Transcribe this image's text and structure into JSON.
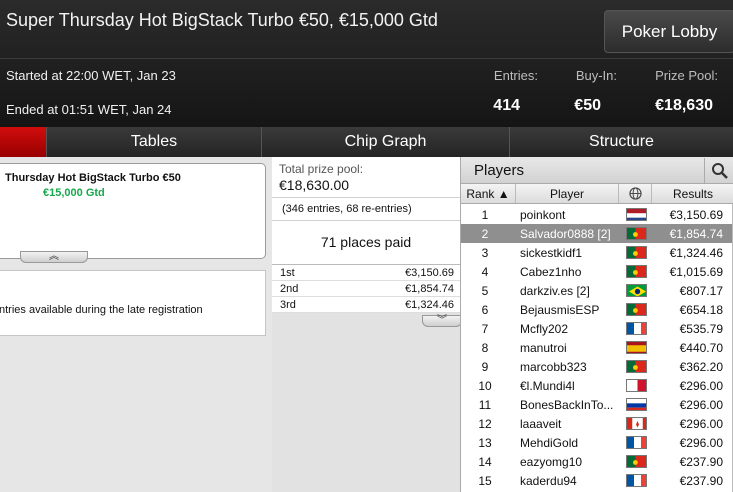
{
  "header": {
    "title": "Super Thursday Hot BigStack Turbo €50, €15,000 Gtd",
    "lobby_button": "Poker Lobby",
    "started": "Started at 22:00 WET, Jan 23",
    "ended": "Ended at 01:51 WET, Jan 24",
    "stats": {
      "entries_label": "Entries:",
      "entries_value": "414",
      "buyin_label": "Buy-In:",
      "buyin_value": "€50",
      "prize_label": "Prize Pool:",
      "prize_value": "€18,630"
    }
  },
  "tabs": [
    "",
    "Tables",
    "Chip Graph",
    "Structure"
  ],
  "left": {
    "card_title": "Thursday Hot BigStack Turbo €50",
    "card_gtd": "€15,000 Gtd",
    "expand_glyph": "︽",
    "note": "ntries available during the late registration"
  },
  "prize": {
    "label": "Total prize pool:",
    "value": "€18,630.00",
    "entries_note": "(346 entries, 68 re-entries)",
    "places": "71 places paid",
    "payouts": [
      {
        "place": "1st",
        "amount": "€3,150.69"
      },
      {
        "place": "2nd",
        "amount": "€1,854.74"
      },
      {
        "place": "3rd",
        "amount": "€1,324.46"
      }
    ],
    "expand_glyph": "︾"
  },
  "players": {
    "title": "Players",
    "search_icon": "magnifier-icon",
    "columns": {
      "rank": "Rank ▲",
      "player": "Player",
      "country": "globe-icon",
      "results": "Results"
    },
    "rows": [
      {
        "rank": "1",
        "name": "poinkont",
        "flag": "netherlands",
        "result": "€3,150.69"
      },
      {
        "rank": "2",
        "name": "Salvador0888 [2]",
        "flag": "portugal",
        "result": "€1,854.74"
      },
      {
        "rank": "3",
        "name": "sickestkidf1",
        "flag": "portugal",
        "result": "€1,324.46"
      },
      {
        "rank": "4",
        "name": "Cabez1nho",
        "flag": "portugal",
        "result": "€1,015.69"
      },
      {
        "rank": "5",
        "name": "darkziv.es [2]",
        "flag": "brazil",
        "result": "€807.17"
      },
      {
        "rank": "6",
        "name": "BejausmisESP",
        "flag": "portugal",
        "result": "€654.18"
      },
      {
        "rank": "7",
        "name": "Mcfly202",
        "flag": "france",
        "result": "€535.79"
      },
      {
        "rank": "8",
        "name": "manutroi",
        "flag": "spain",
        "result": "€440.70"
      },
      {
        "rank": "9",
        "name": "marcobb323",
        "flag": "portugal",
        "result": "€362.20"
      },
      {
        "rank": "10",
        "name": "€l.Mundi4l",
        "flag": "malta",
        "result": "€296.00"
      },
      {
        "rank": "11",
        "name": "BonesBackInTo...",
        "flag": "russia",
        "result": "€296.00"
      },
      {
        "rank": "12",
        "name": "laaaveit",
        "flag": "canada",
        "result": "€296.00"
      },
      {
        "rank": "13",
        "name": "MehdiGold",
        "flag": "france",
        "result": "€296.00"
      },
      {
        "rank": "14",
        "name": "eazyomg10",
        "flag": "portugal",
        "result": "€237.90"
      },
      {
        "rank": "15",
        "name": "kaderdu94",
        "flag": "france",
        "result": "€237.90"
      }
    ],
    "selected_rank": "2"
  }
}
